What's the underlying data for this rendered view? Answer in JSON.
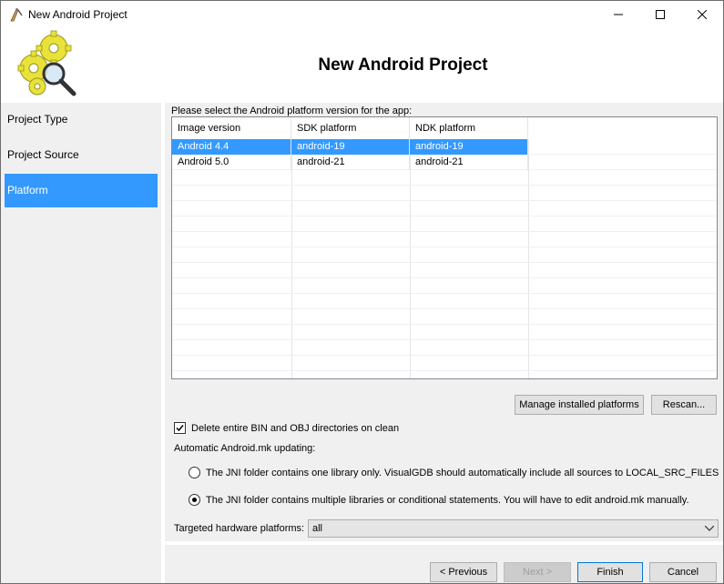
{
  "window": {
    "title": "New Android Project",
    "heading": "New Android Project"
  },
  "sidebar": {
    "items": [
      {
        "label": "Project Type"
      },
      {
        "label": "Project Source"
      },
      {
        "label": "Platform"
      }
    ]
  },
  "platform": {
    "prompt": "Please select the Android platform version for the app:",
    "columns": [
      "Image version",
      "SDK platform",
      "NDK platform"
    ],
    "rows": [
      {
        "image": "Android 4.4",
        "sdk": "android-19",
        "ndk": "android-19"
      },
      {
        "image": "Android 5.0",
        "sdk": "android-21",
        "ndk": "android-21"
      }
    ],
    "selected_row": 0
  },
  "buttons": {
    "manage": "Manage installed platforms",
    "rescan": "Rescan...",
    "previous": "< Previous",
    "next": "Next >",
    "finish": "Finish",
    "cancel": "Cancel"
  },
  "options": {
    "delete_dirs_label": "Delete entire BIN and OBJ directories on clean",
    "delete_dirs_checked": true,
    "mk_updating_label": "Automatic Android.mk updating:",
    "radio_one_library": "The JNI folder contains one library only. VisualGDB should automatically include all sources to LOCAL_SRC_FILES",
    "radio_multiple": "The JNI folder contains multiple libraries or conditional statements. You will have to edit android.mk manually.",
    "selected_radio": "multiple",
    "targeted_label": "Targeted hardware platforms:",
    "targeted_value": "all"
  },
  "colors": {
    "selection": "#3399ff",
    "panel": "#f0f0f0"
  },
  "icons": {
    "app": "pencil-compass-icon",
    "logo": "gears-magnifier-icon"
  }
}
